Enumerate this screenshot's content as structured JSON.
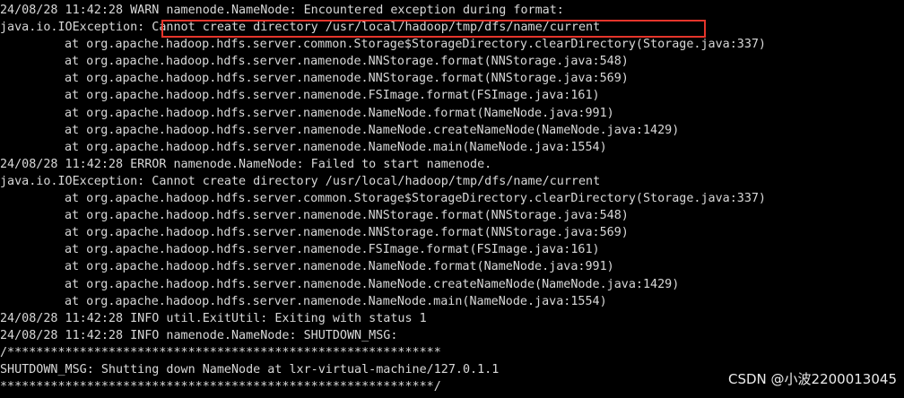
{
  "terminal": {
    "lines": [
      "24/08/28 11:42:28 WARN namenode.NameNode: Encountered exception during format:",
      "java.io.IOException: Cannot create directory /usr/local/hadoop/tmp/dfs/name/current",
      "at org.apache.hadoop.hdfs.server.common.Storage$StorageDirectory.clearDirectory(Storage.java:337)",
      "at org.apache.hadoop.hdfs.server.namenode.NNStorage.format(NNStorage.java:548)",
      "at org.apache.hadoop.hdfs.server.namenode.NNStorage.format(NNStorage.java:569)",
      "at org.apache.hadoop.hdfs.server.namenode.FSImage.format(FSImage.java:161)",
      "at org.apache.hadoop.hdfs.server.namenode.NameNode.format(NameNode.java:991)",
      "at org.apache.hadoop.hdfs.server.namenode.NameNode.createNameNode(NameNode.java:1429)",
      "at org.apache.hadoop.hdfs.server.namenode.NameNode.main(NameNode.java:1554)",
      "24/08/28 11:42:28 ERROR namenode.NameNode: Failed to start namenode.",
      "java.io.IOException: Cannot create directory /usr/local/hadoop/tmp/dfs/name/current",
      "at org.apache.hadoop.hdfs.server.common.Storage$StorageDirectory.clearDirectory(Storage.java:337)",
      "at org.apache.hadoop.hdfs.server.namenode.NNStorage.format(NNStorage.java:548)",
      "at org.apache.hadoop.hdfs.server.namenode.NNStorage.format(NNStorage.java:569)",
      "at org.apache.hadoop.hdfs.server.namenode.FSImage.format(FSImage.java:161)",
      "at org.apache.hadoop.hdfs.server.namenode.NameNode.format(NameNode.java:991)",
      "at org.apache.hadoop.hdfs.server.namenode.NameNode.createNameNode(NameNode.java:1429)",
      "at org.apache.hadoop.hdfs.server.namenode.NameNode.main(NameNode.java:1554)",
      "24/08/28 11:42:28 INFO util.ExitUtil: Exiting with status 1",
      "24/08/28 11:42:28 INFO namenode.NameNode: SHUTDOWN_MSG:",
      "/************************************************************",
      "SHUTDOWN_MSG: Shutting down NameNode at lxr-virtual-machine/127.0.1.1",
      "************************************************************/"
    ],
    "highlighted_text": "Cannot create directory /usr/local/hadoop/tmp/dfs/name/current",
    "colors": {
      "background": "#000000",
      "text": "#d8d8d8",
      "highlight_border": "#e5352b"
    }
  },
  "watermark": {
    "text": "CSDN @小波2200013045"
  }
}
